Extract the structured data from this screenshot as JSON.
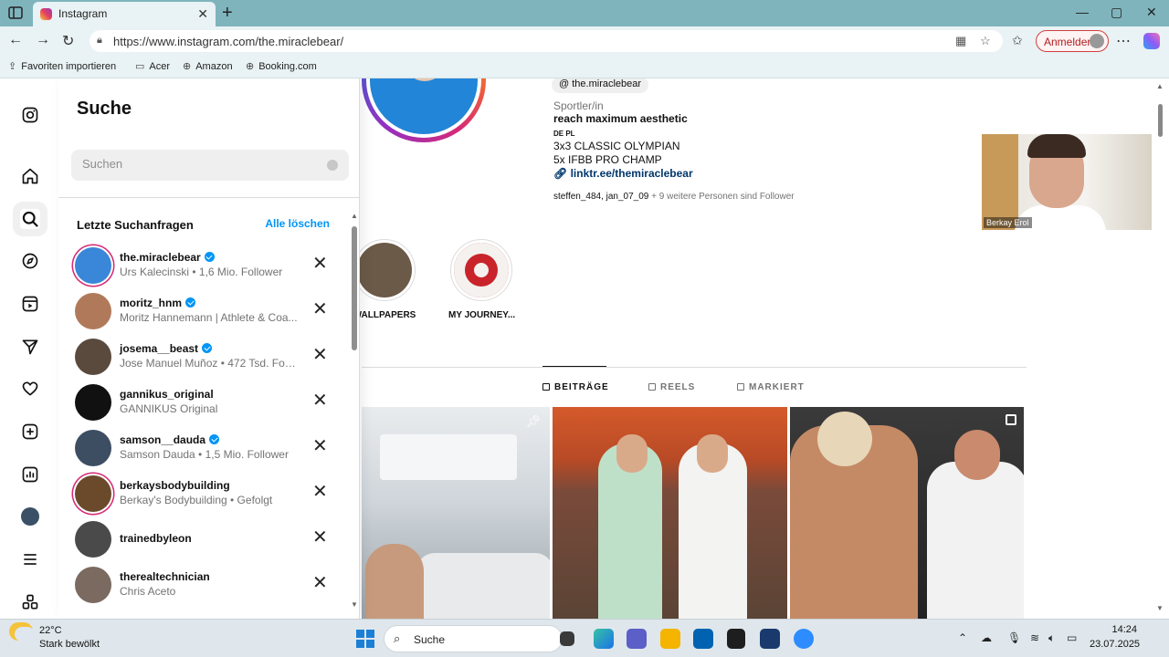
{
  "browser": {
    "tab_title": "Instagram",
    "url": "https://www.instagram.com/the.miraclebear/",
    "signin_label": "Anmelden",
    "favorites": [
      {
        "icon": "import-icon",
        "label": "Favoriten importieren"
      },
      {
        "icon": "folder-icon",
        "label": "Acer"
      },
      {
        "icon": "globe-icon",
        "label": "Amazon"
      },
      {
        "icon": "globe-icon",
        "label": "Booking.com"
      }
    ]
  },
  "search_panel": {
    "title": "Suche",
    "input_value": "",
    "placeholder": "Suchen",
    "recent_title": "Letzte Suchanfragen",
    "clear_all": "Alle löschen",
    "results": [
      {
        "username": "the.miraclebear",
        "verified": true,
        "subtitle": "Urs Kalecinski • 1,6 Mio. Follower",
        "story_ring": true,
        "avatar_color": "#3a86d8"
      },
      {
        "username": "moritz_hnm",
        "verified": true,
        "subtitle": "Moritz Hannemann | Athlete & Coa...",
        "story_ring": false,
        "avatar_color": "#b07a5a"
      },
      {
        "username": "josema__beast",
        "verified": true,
        "subtitle": "Jose Manuel Muñoz • 472 Tsd. Follo...",
        "story_ring": false,
        "avatar_color": "#5a4a3e"
      },
      {
        "username": "gannikus_original",
        "verified": false,
        "subtitle": "GANNIKUS Original",
        "story_ring": false,
        "avatar_color": "#111111"
      },
      {
        "username": "samson__dauda",
        "verified": true,
        "subtitle": "Samson Dauda • 1,5 Mio. Follower",
        "story_ring": false,
        "avatar_color": "#3d4e63"
      },
      {
        "username": "berkaysbodybuilding",
        "verified": false,
        "subtitle": "Berkay's Bodybuilding • Gefolgt",
        "story_ring": true,
        "avatar_color": "#6a4a2a"
      },
      {
        "username": "trainedbyleon",
        "verified": false,
        "subtitle": "",
        "story_ring": false,
        "avatar_color": "#4a4a4a"
      },
      {
        "username": "therealtechnician",
        "verified": false,
        "subtitle": "Chris Aceto",
        "story_ring": false,
        "avatar_color": "#7a6a60"
      }
    ]
  },
  "profile": {
    "threads_handle": "the.miraclebear",
    "category": "Sportler/in",
    "bio_line1": "reach maximum aesthetic",
    "bio_line2": "DE PL",
    "bio_line3": "3x3 CLASSIC OLYMPIAN",
    "bio_line4": "5x IFBB PRO CHAMP",
    "link": "linktr.ee/themiraclebear",
    "followed_by_names": "steffen_484, jan_07_09",
    "followed_by_rest": " + 9 weitere Personen sind Follower",
    "highlights": [
      "WALLPAPERS",
      "MY JOURNEY..."
    ],
    "tabs": [
      "BEITRÄGE",
      "REELS",
      "MARKIERT"
    ]
  },
  "video_call": {
    "name": "Berkay Erol"
  },
  "taskbar": {
    "temperature": "22°C",
    "weather": "Stark bewölkt",
    "search_label": "Suche",
    "time": "14:24",
    "date": "23.07.2025"
  },
  "colors": {
    "accent_blue": "#0095f6",
    "story_ring": "#d62976",
    "browser_tab_bar": "#7fb4bd"
  }
}
